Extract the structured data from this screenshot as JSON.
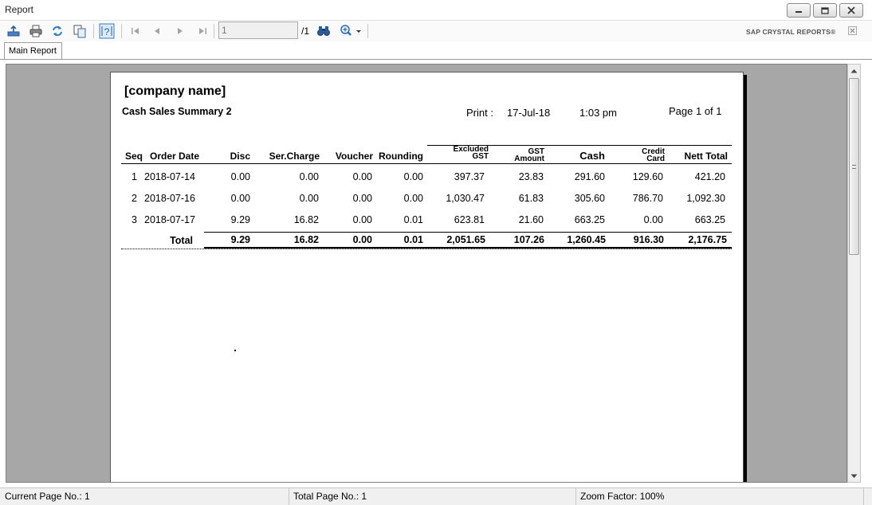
{
  "window": {
    "title": "Report"
  },
  "toolbar": {
    "page_input_value": "1",
    "page_total": "/1",
    "brand": "SAP CRYSTAL REPORTS®"
  },
  "tabs": [
    {
      "label": "Main Report"
    }
  ],
  "report": {
    "company": "[company name]",
    "title": "Cash Sales Summary 2",
    "print_label": "Print :",
    "print_date": "17-Jul-18",
    "print_time": "1:03 pm",
    "page_info": "Page 1 of 1",
    "headers": {
      "seq": "Seq",
      "order_date": "Order Date",
      "disc": "Disc",
      "ser_charge": "Ser.Charge",
      "voucher": "Voucher",
      "rounding": "Rounding",
      "excluded_gst_1": "Excluded",
      "excluded_gst_2": "GST",
      "gst_amount_1": "GST",
      "gst_amount_2": "Amount",
      "cash": "Cash",
      "credit_card_1": "Credit",
      "credit_card_2": "Card",
      "nett_total": "Nett Total"
    },
    "rows": [
      {
        "seq": "1",
        "date": "2018-07-14",
        "disc": "0.00",
        "ser": "0.00",
        "voucher": "0.00",
        "rounding": "0.00",
        "excl": "397.37",
        "gst": "23.83",
        "cash": "291.60",
        "credit": "129.60",
        "nett": "421.20"
      },
      {
        "seq": "2",
        "date": "2018-07-16",
        "disc": "0.00",
        "ser": "0.00",
        "voucher": "0.00",
        "rounding": "0.00",
        "excl": "1,030.47",
        "gst": "61.83",
        "cash": "305.60",
        "credit": "786.70",
        "nett": "1,092.30"
      },
      {
        "seq": "3",
        "date": "2018-07-17",
        "disc": "9.29",
        "ser": "16.82",
        "voucher": "0.00",
        "rounding": "0.01",
        "excl": "623.81",
        "gst": "21.60",
        "cash": "663.25",
        "credit": "0.00",
        "nett": "663.25"
      }
    ],
    "total": {
      "label": "Total",
      "disc": "9.29",
      "ser": "16.82",
      "voucher": "0.00",
      "rounding": "0.01",
      "excl": "2,051.65",
      "gst": "107.26",
      "cash": "1,260.45",
      "credit": "916.30",
      "nett": "2,176.75"
    }
  },
  "status": {
    "current_page": "Current Page No.: 1",
    "total_page": "Total Page No.: 1",
    "zoom": "Zoom Factor: 100%"
  }
}
